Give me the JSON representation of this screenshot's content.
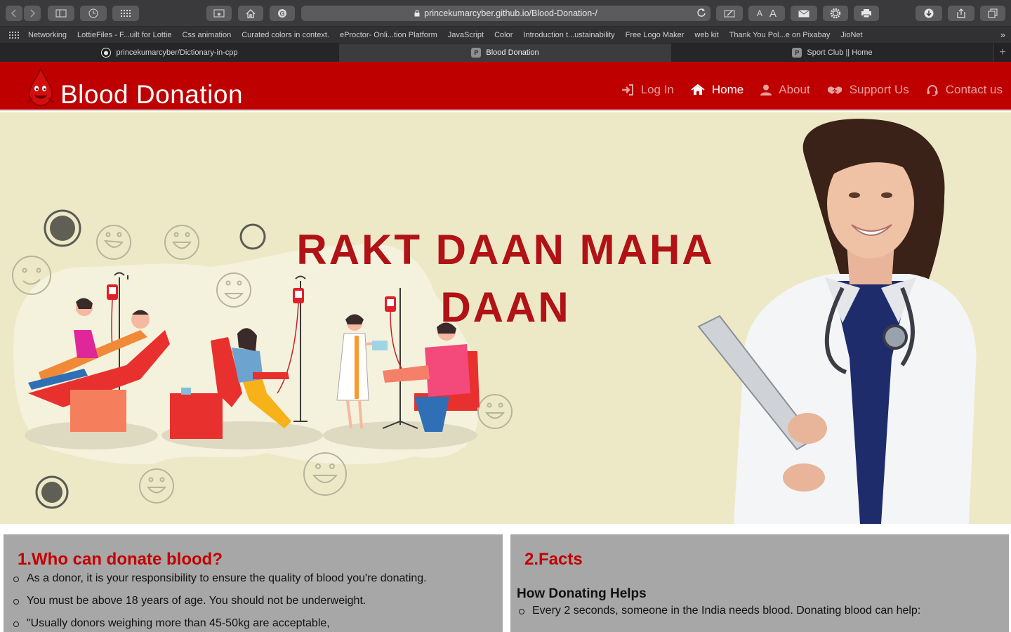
{
  "browser": {
    "url": "princekumarcyber.github.io/Blood-Donation-/",
    "zoom_small_label": "A",
    "zoom_large_label": "A",
    "bookmarks": [
      "Networking",
      "LottieFiles - F...uilt for Lottie",
      "Css animation",
      "Curated colors in context.",
      "eProctor- Onli...tion Platform",
      "JavaScript",
      "Color",
      "Introduction t...ustainability",
      "Free Logo Maker",
      "web kit",
      "Thank You Pol...e on Pixabay",
      "JioNet"
    ],
    "tabs": [
      {
        "label": "princekumarcyber/Dictionary-in-cpp",
        "favicon": "github-icon",
        "active": false
      },
      {
        "label": "Blood Donation",
        "favicon": "P",
        "active": true
      },
      {
        "label": "Sport Club || Home",
        "favicon": "P",
        "active": false
      }
    ]
  },
  "site": {
    "brand": "Blood Donation",
    "colors": {
      "header": "#bf0000",
      "hero_bg": "#ede9c7",
      "title": "#b01216",
      "card_bg": "#a7a7a7"
    },
    "nav": [
      {
        "label": "Log In",
        "icon": "sign-in-icon",
        "active": false
      },
      {
        "label": "Home",
        "icon": "home-icon",
        "active": true
      },
      {
        "label": "About",
        "icon": "user-icon",
        "active": false
      },
      {
        "label": "Support Us",
        "icon": "handshake-icon",
        "active": false
      },
      {
        "label": "Contact us",
        "icon": "headset-icon",
        "active": false
      }
    ]
  },
  "hero": {
    "title_line1": "RAKT DAAN MAHA",
    "title_line2": "DAAN"
  },
  "cards": {
    "left": {
      "heading": "1.Who can donate blood?",
      "items": [
        "As a donor, it is your responsibility to ensure the quality of blood you're donating.",
        "You must be above 18 years of age. You should not be underweight.",
        "\"Usually donors weighing more than 45-50kg are acceptable,"
      ]
    },
    "right": {
      "heading": "2.Facts",
      "subheading": "How Donating Helps",
      "items": [
        "Every 2 seconds, someone in the India needs blood. Donating blood can help:"
      ]
    }
  }
}
